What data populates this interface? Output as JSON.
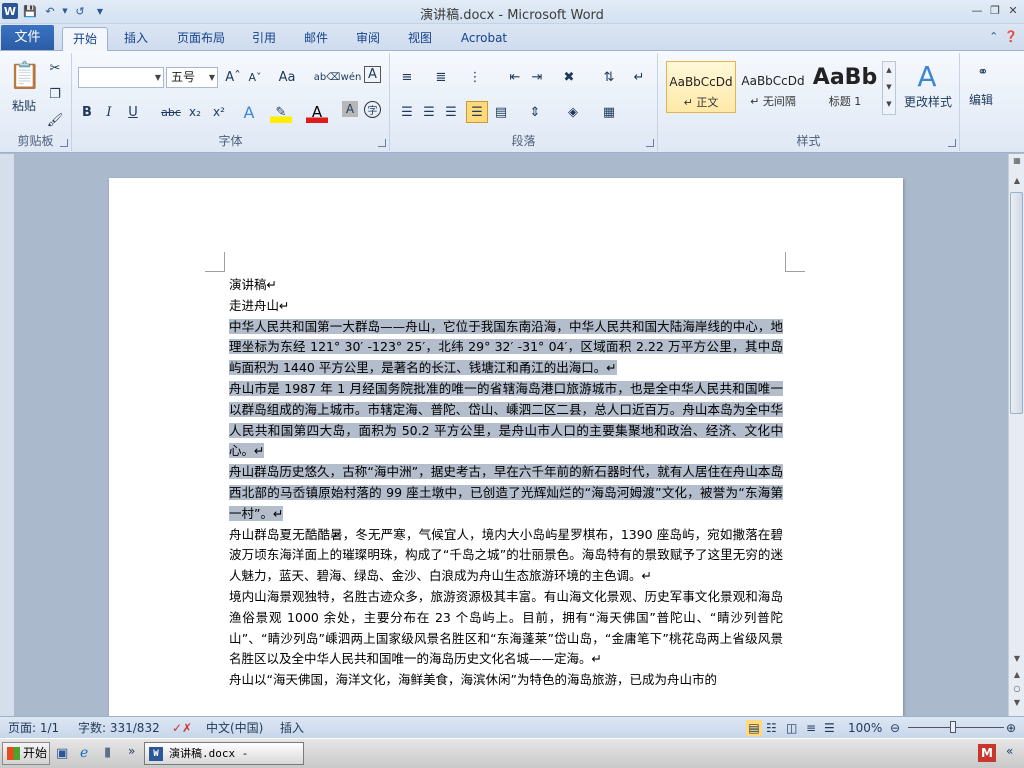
{
  "window": {
    "title": "演讲稿.docx - Microsoft Word",
    "app_icon": "W",
    "controls": [
      "minimize-icon",
      "restore-icon",
      "close-icon"
    ]
  },
  "tabs": {
    "file": "文件",
    "items": [
      "开始",
      "插入",
      "页面布局",
      "引用",
      "邮件",
      "审阅",
      "视图",
      "Acrobat"
    ],
    "active": "开始"
  },
  "ribbon": {
    "clipboard": {
      "label": "剪贴板",
      "paste": "粘贴"
    },
    "font": {
      "label": "字体",
      "font_name": "",
      "font_size": "五号",
      "bold": "B",
      "italic": "I",
      "underline": "U",
      "strike": "abc",
      "sub": "x₂",
      "sup": "x²"
    },
    "paragraph": {
      "label": "段落"
    },
    "styles": {
      "label": "样式",
      "items": [
        {
          "sample": "AaBbCcDd",
          "name": "↵ 正文"
        },
        {
          "sample": "AaBbCcDd",
          "name": "↵ 无间隔"
        },
        {
          "sample": "AaBb",
          "name": "标题 1"
        }
      ],
      "change": "更改样式"
    },
    "editing": {
      "label": "编辑"
    }
  },
  "document": {
    "paragraphs": [
      {
        "text": "演讲稿↵",
        "highlight": false
      },
      {
        "text": "走进舟山↵",
        "highlight": false
      },
      {
        "text": "中华人民共和国第一大群岛——舟山，它位于我国东南沿海，中华人民共和国大陆海岸线的中心，地理坐标为东经 121° 30′ -123° 25′，北纬 29° 32′ -31° 04′，区域面积 2.22 万平方公里，其中岛屿面积为 1440 平方公里，是著名的长江、钱塘江和甬江的出海口。↵",
        "highlight": true
      },
      {
        "text": "舟山市是 1987 年 1 月经国务院批准的唯一的省辖海岛港口旅游城市，也是全中华人民共和国唯一以群岛组成的海上城市。市辖定海、普陀、岱山、嵊泗二区二县，总人口近百万。舟山本岛为全中华人民共和国第四大岛，面积为 50.2 平方公里，是舟山市人口的主要集聚地和政治、经济、文化中心。↵",
        "highlight": true
      },
      {
        "text": "舟山群岛历史悠久，古称“海中洲”，据史考古，早在六千年前的新石器时代，就有人居住在舟山本岛西北部的马岙镇原始村落的 99 座土墩中，已创造了光辉灿烂的“海岛河姆渡”文化，被誉为“东海第一村”。↵",
        "highlight": true
      },
      {
        "text": "舟山群岛夏无酷酷暑，冬无严寒，气候宜人，境内大小岛屿星罗棋布，1390 座岛屿，宛如撒落在碧波万顷东海洋面上的璀璨明珠，构成了“千岛之城”的壮丽景色。海岛特有的景致赋予了这里无穷的迷人魅力，蓝天、碧海、绿岛、金沙、白浪成为舟山生态旅游环境的主色调。↵",
        "highlight": false
      },
      {
        "text": "境内山海景观独特，名胜古迹众多，旅游资源极其丰富。有山海文化景观、历史军事文化景观和海岛渔俗景观 1000 余处，主要分布在 23 个岛屿上。目前，拥有“海天佛国”普陀山、“睛沙列普陀山”、“睛沙列岛”嵊泗两上国家级风景名胜区和“东海蓬莱”岱山岛，“金庸笔下”桃花岛两上省级风景名胜区以及全中华人民共和国唯一的海岛历史文化名城——定海。↵",
        "highlight": false
      },
      {
        "text": "舟山以“海天佛国，海洋文化，海鲜美食，海滨休闲”为特色的海岛旅游，已成为舟山市的",
        "highlight": false
      }
    ]
  },
  "status": {
    "page": "页面: 1/1",
    "words": "字数: 331/832",
    "language": "中文(中国)",
    "mode": "插入",
    "zoom": "100%",
    "zoom_level": 1.0
  },
  "taskbar": {
    "start": "开始",
    "window_item": "演讲稿.docx - Micro..."
  }
}
